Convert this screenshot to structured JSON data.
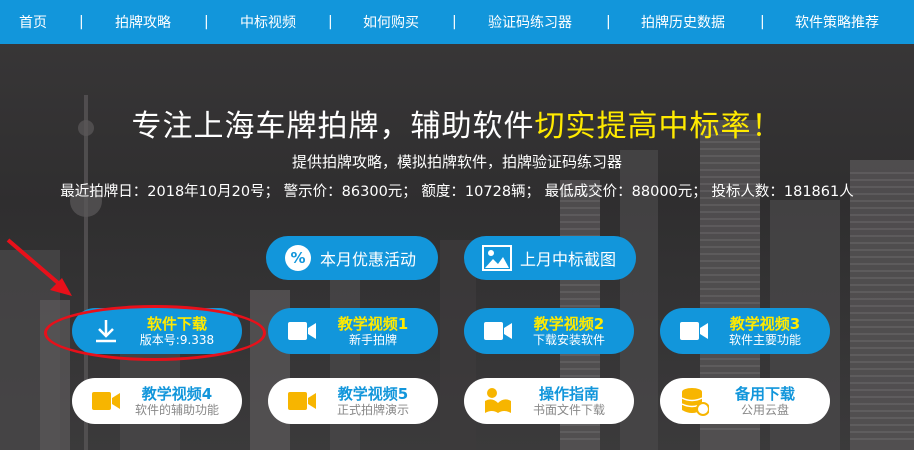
{
  "nav": {
    "items": [
      {
        "label": "首页"
      },
      {
        "label": "拍牌攻略"
      },
      {
        "label": "中标视频"
      },
      {
        "label": "如何购买"
      },
      {
        "label": "验证码练习器"
      },
      {
        "label": "拍牌历史数据"
      },
      {
        "label": "软件策略推荐"
      }
    ],
    "separator": "|"
  },
  "hero": {
    "headline_main": "专注上海车牌拍牌，辅助软件",
    "headline_highlight": "切实提高中标率！",
    "subline": "提供拍牌攻略，模拟拍牌软件，拍牌验证码练习器",
    "info": "最近拍牌日：2018年10月20号； 警示价：86300元； 额度：10728辆； 最低成交价：88000元； 投标人数：181861人"
  },
  "promo": {
    "monthly_label": "本月优惠活动",
    "screenshot_label": "上月中标截图"
  },
  "downloads": {
    "software": {
      "title": "软件下载",
      "sub": "版本号:9.338"
    },
    "video1": {
      "title": "教学视频1",
      "sub": "新手拍牌"
    },
    "video2": {
      "title": "教学视频2",
      "sub": "下载安装软件"
    },
    "video3": {
      "title": "教学视频3",
      "sub": "软件主要功能"
    },
    "video4": {
      "title": "教学视频4",
      "sub": "软件的辅助功能"
    },
    "video5": {
      "title": "教学视频5",
      "sub": "正式拍牌演示"
    },
    "guide": {
      "title": "操作指南",
      "sub": "书面文件下载"
    },
    "backup": {
      "title": "备用下载",
      "sub": "公用云盘"
    }
  },
  "colors": {
    "nav_bg": "#1296db",
    "accent_yellow": "#ffea00",
    "highlight_red": "#e8101a",
    "icon_yellow": "#f7b500"
  }
}
